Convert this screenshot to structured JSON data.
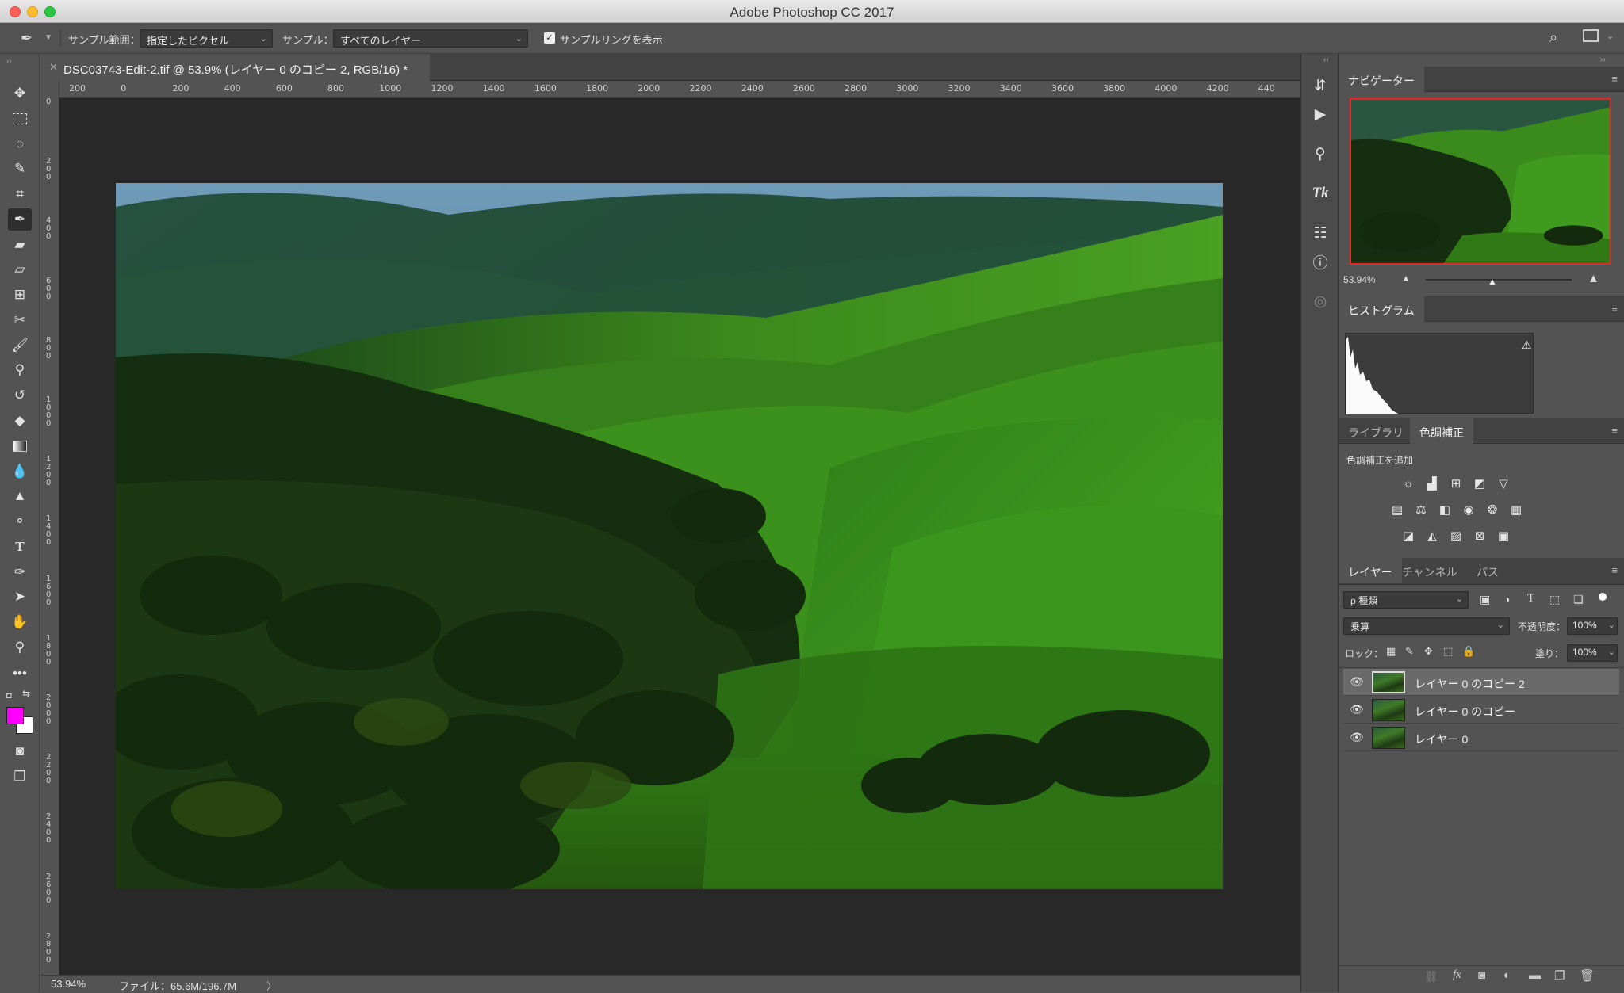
{
  "window": {
    "title": "Adobe Photoshop CC 2017"
  },
  "options_bar": {
    "sample_size_label": "サンプル範囲：",
    "sample_size_value": "指定したピクセル",
    "sample_label": "サンプル：",
    "sample_value": "すべてのレイヤー",
    "show_ring_label": "サンプルリングを表示"
  },
  "document": {
    "tab_title": "DSC03743-Edit-2.tif @ 53.9% (レイヤー 0 のコピー 2, RGB/16) *",
    "h_ruler": [
      "200",
      "0",
      "200",
      "400",
      "600",
      "800",
      "1000",
      "1200",
      "1400",
      "1600",
      "1800",
      "2000",
      "2200",
      "2400",
      "2600",
      "2800",
      "3000",
      "3200",
      "3400",
      "3600",
      "3800",
      "4000",
      "4200",
      "440"
    ],
    "v_ruler": [
      "0",
      "2\n0\n0",
      "4\n0\n0",
      "6\n0\n0",
      "8\n0\n0",
      "1\n0\n0\n0",
      "1\n2\n0\n0",
      "1\n4\n0\n0",
      "1\n6\n0\n0",
      "1\n8\n0\n0",
      "2\n0\n0\n0",
      "2\n2\n0\n0",
      "2\n4\n0\n0",
      "2\n6\n0\n0",
      "2\n8\n0\n0"
    ]
  },
  "status": {
    "zoom": "53.94%",
    "file_info": "ファイル：65.6M/196.7M",
    "arrow": "〉"
  },
  "navigator": {
    "tab": "ナビゲーター",
    "zoom": "53.94%"
  },
  "histogram": {
    "tab": "ヒストグラム"
  },
  "adjustments": {
    "tab_library": "ライブラリ",
    "tab_adjust": "色調補正",
    "add_label": "色調補正を追加"
  },
  "layers": {
    "tab_layers": "レイヤー",
    "tab_channels": "チャンネル",
    "tab_paths": "パス",
    "filter_kind": "ρ 種類",
    "blend_mode": "乗算",
    "opacity_label": "不透明度：",
    "opacity_value": "100%",
    "lock_label": "ロック：",
    "fill_label": "塗り：",
    "fill_value": "100%",
    "items": [
      {
        "name": "レイヤー 0 のコピー 2"
      },
      {
        "name": "レイヤー 0 のコピー"
      },
      {
        "name": "レイヤー 0"
      }
    ]
  },
  "colors": {
    "foreground": "#ff00ff",
    "background": "#ffffff"
  }
}
